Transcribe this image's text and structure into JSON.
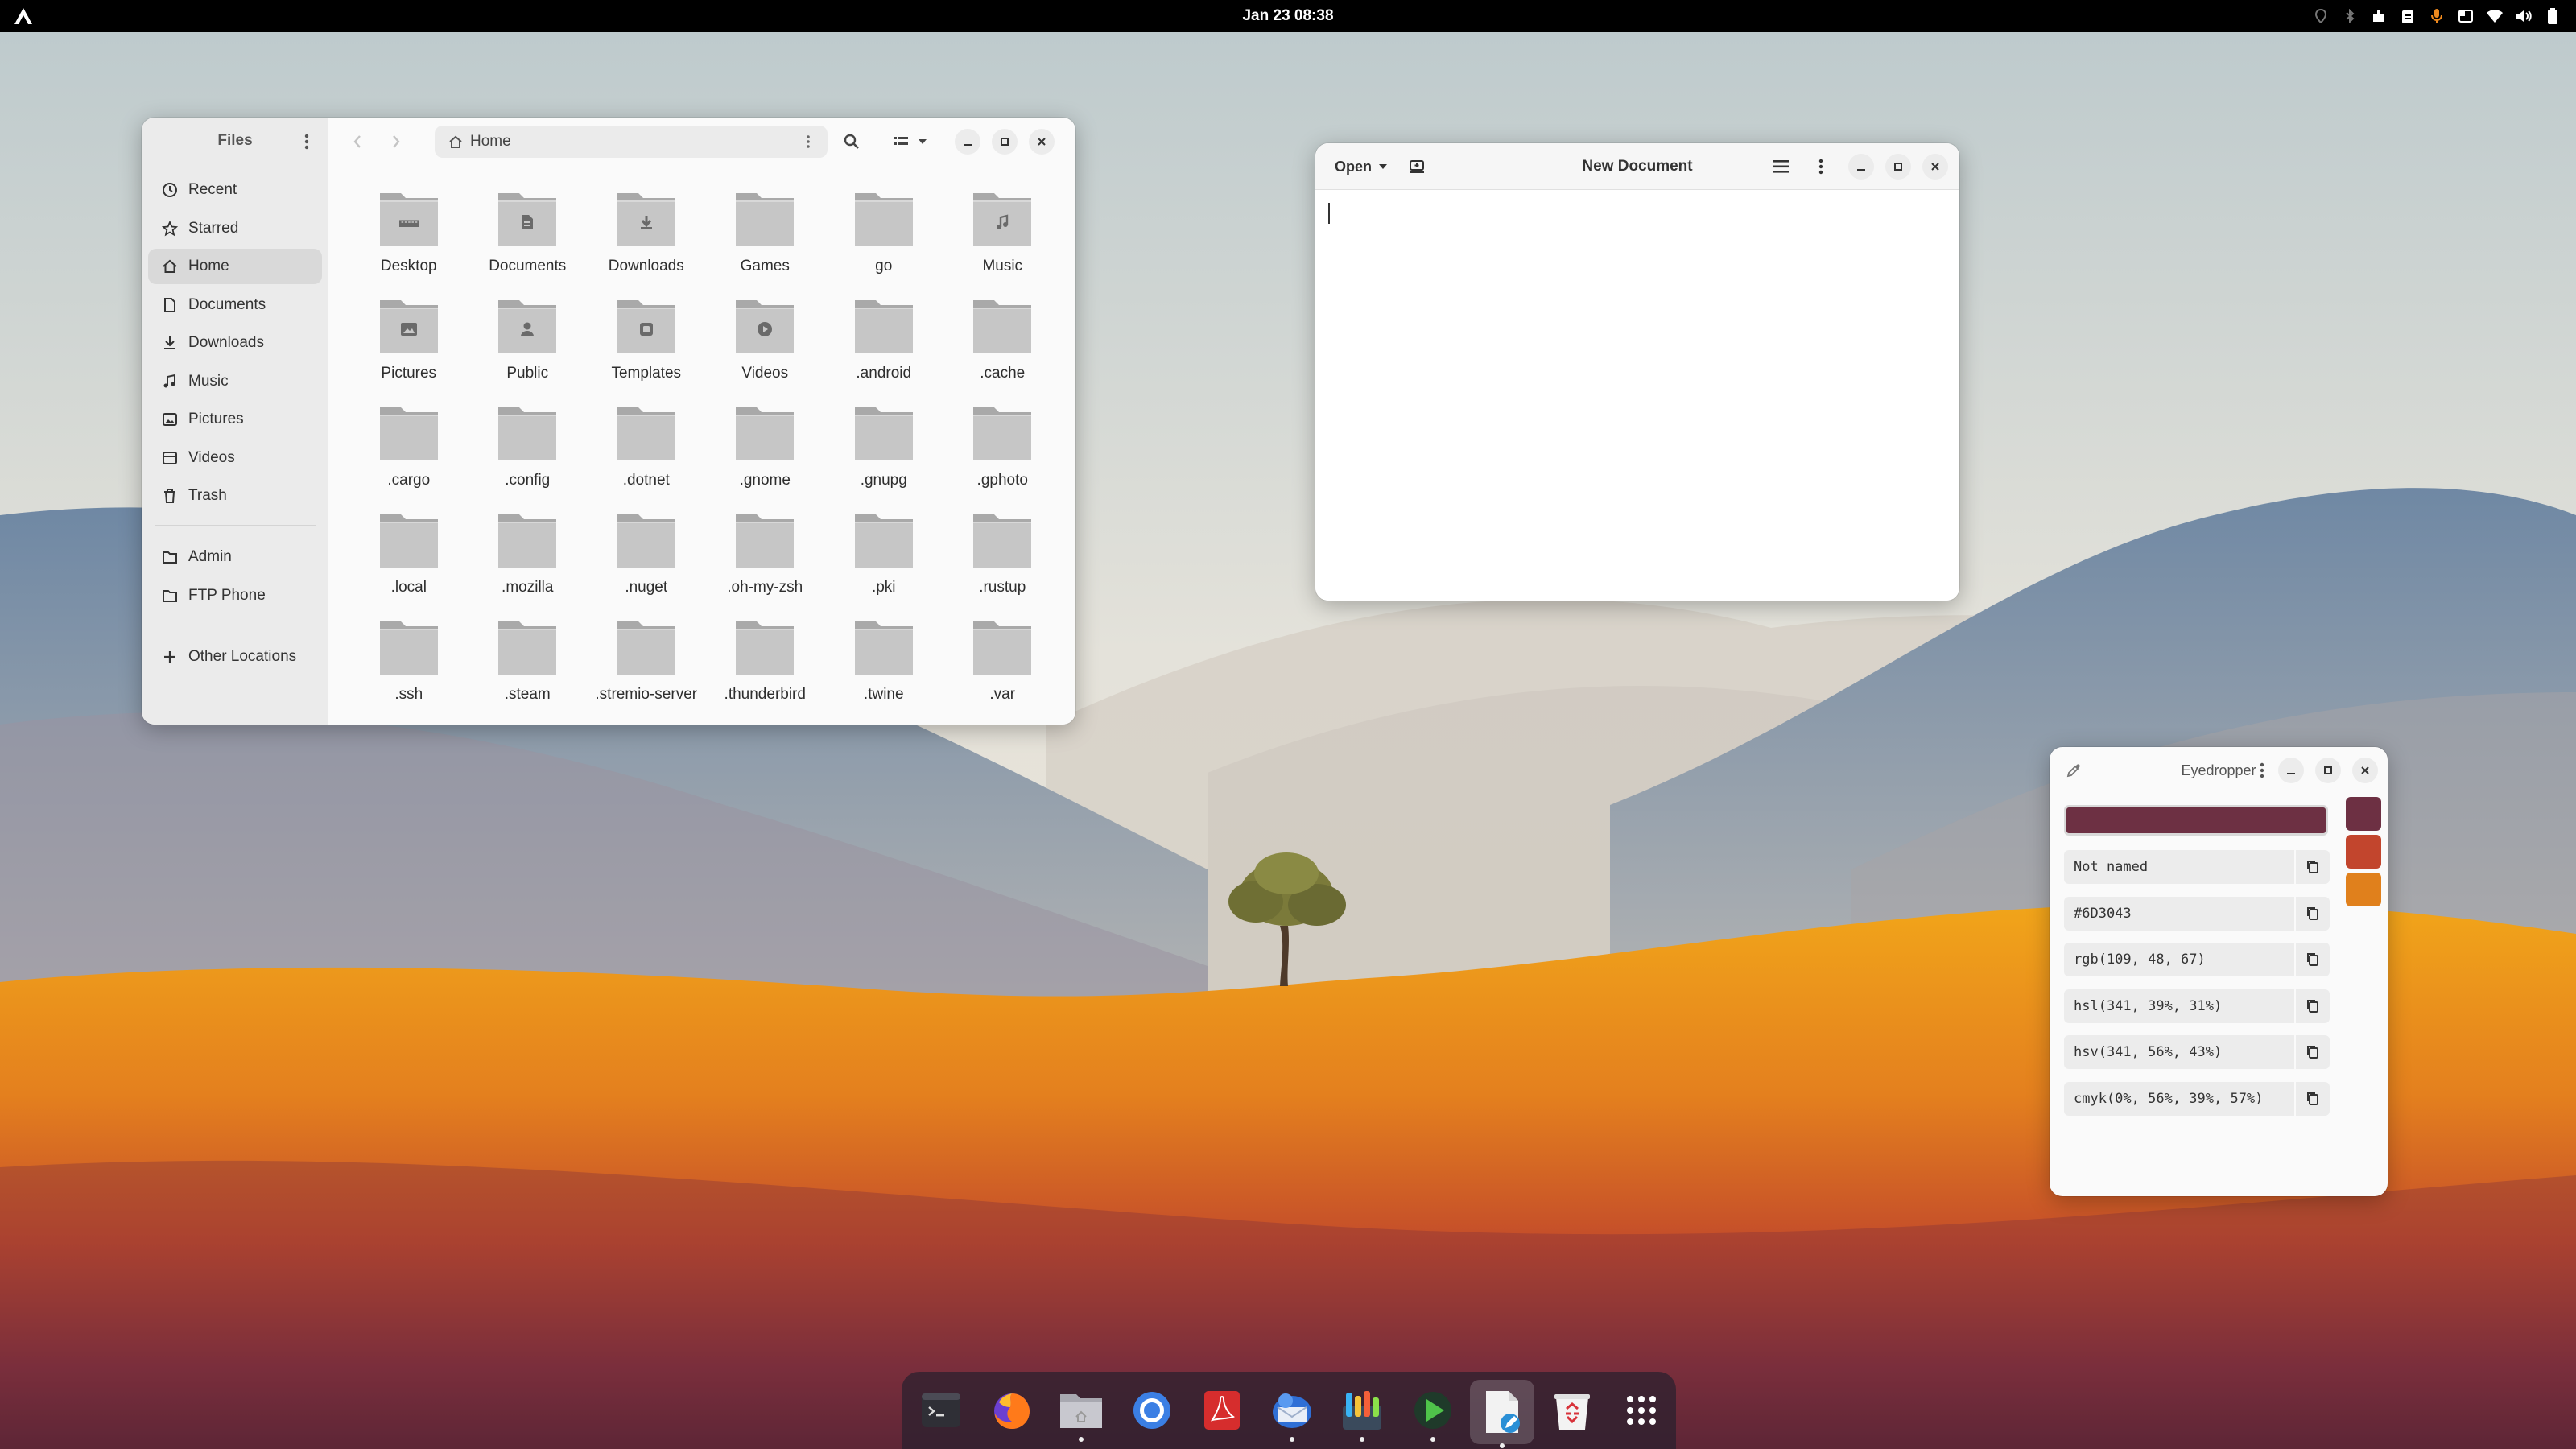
{
  "topbar": {
    "datetime": "Jan 23  08:38",
    "tray_icons": [
      "location-icon",
      "bluetooth-icon",
      "extensions-icon",
      "clipboard-icon",
      "microphone-icon",
      "screen-icon",
      "wifi-icon",
      "volume-icon",
      "battery-icon"
    ]
  },
  "files": {
    "title": "Files",
    "path": "Home",
    "sidebar": [
      {
        "label": "Recent",
        "icon": "clock-icon"
      },
      {
        "label": "Starred",
        "icon": "star-icon"
      },
      {
        "label": "Home",
        "icon": "home-icon",
        "active": true
      },
      {
        "label": "Documents",
        "icon": "document-icon"
      },
      {
        "label": "Downloads",
        "icon": "download-icon"
      },
      {
        "label": "Music",
        "icon": "music-icon"
      },
      {
        "label": "Pictures",
        "icon": "picture-icon"
      },
      {
        "label": "Videos",
        "icon": "video-icon"
      },
      {
        "label": "Trash",
        "icon": "trash-icon"
      }
    ],
    "bookmarks": [
      {
        "label": "Admin",
        "icon": "folder-icon"
      },
      {
        "label": "FTP Phone",
        "icon": "folder-icon"
      }
    ],
    "other_locations": "Other Locations",
    "folders": [
      {
        "name": "Desktop",
        "emblem": "desktop"
      },
      {
        "name": "Documents",
        "emblem": "document"
      },
      {
        "name": "Downloads",
        "emblem": "download"
      },
      {
        "name": "Games",
        "emblem": ""
      },
      {
        "name": "go",
        "emblem": ""
      },
      {
        "name": "Music",
        "emblem": "music"
      },
      {
        "name": "Pictures",
        "emblem": "picture"
      },
      {
        "name": "Public",
        "emblem": "person"
      },
      {
        "name": "Templates",
        "emblem": "template"
      },
      {
        "name": "Videos",
        "emblem": "video"
      },
      {
        "name": ".android",
        "emblem": ""
      },
      {
        "name": ".cache",
        "emblem": ""
      },
      {
        "name": ".cargo",
        "emblem": ""
      },
      {
        "name": ".config",
        "emblem": ""
      },
      {
        "name": ".dotnet",
        "emblem": ""
      },
      {
        "name": ".gnome",
        "emblem": ""
      },
      {
        "name": ".gnupg",
        "emblem": ""
      },
      {
        "name": ".gphoto",
        "emblem": ""
      },
      {
        "name": ".local",
        "emblem": ""
      },
      {
        "name": ".mozilla",
        "emblem": ""
      },
      {
        "name": ".nuget",
        "emblem": ""
      },
      {
        "name": ".oh-my-zsh",
        "emblem": ""
      },
      {
        "name": ".pki",
        "emblem": ""
      },
      {
        "name": ".rustup",
        "emblem": ""
      },
      {
        "name": ".ssh",
        "emblem": ""
      },
      {
        "name": ".steam",
        "emblem": ""
      },
      {
        "name": ".stremio-server",
        "emblem": ""
      },
      {
        "name": ".thunderbird",
        "emblem": ""
      },
      {
        "name": ".twine",
        "emblem": ""
      },
      {
        "name": ".var",
        "emblem": ""
      }
    ]
  },
  "editor": {
    "open_label": "Open",
    "title": "New Document"
  },
  "eyedropper": {
    "title": "Eyedropper",
    "current_color": "#6D3043",
    "name": "Not named",
    "formats": {
      "hex": "#6D3043",
      "rgb": "rgb(109, 48, 67)",
      "hsl": "hsl(341, 39%, 31%)",
      "hsv": "hsv(341, 56%, 43%)",
      "cmyk": "cmyk(0%, 56%, 39%, 57%)"
    },
    "history": [
      "#6D3043",
      "#C2452D",
      "#E0801C"
    ]
  },
  "dock": {
    "apps": [
      {
        "name": "terminal",
        "running": false
      },
      {
        "name": "firefox",
        "running": false
      },
      {
        "name": "files",
        "running": true
      },
      {
        "name": "chromium",
        "running": false
      },
      {
        "name": "pdf-reader",
        "running": false
      },
      {
        "name": "mail-client",
        "running": true
      },
      {
        "name": "color-palette",
        "running": true
      },
      {
        "name": "media-player",
        "running": true
      },
      {
        "name": "text-editor",
        "running": true,
        "active": true
      },
      {
        "name": "trash",
        "running": false
      },
      {
        "name": "app-grid",
        "running": false
      }
    ]
  }
}
